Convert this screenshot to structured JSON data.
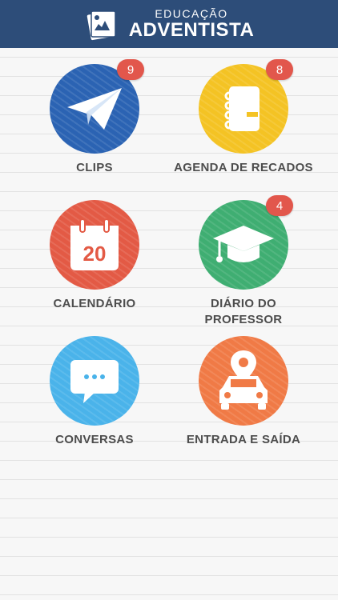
{
  "header": {
    "logo_line1": "EDUCAÇÃO",
    "logo_line2": "ADVENTISTA",
    "bg_color": "#2d4d79"
  },
  "tiles": [
    {
      "label": "CLIPS",
      "badge": "9",
      "icon": "paper-plane-icon",
      "color": "#2b63b3"
    },
    {
      "label": "AGENDA DE RECADOS",
      "badge": "8",
      "icon": "notebook-icon",
      "color": "#f4c324"
    },
    {
      "label": "CALENDÁRIO",
      "badge": "",
      "icon": "calendar-icon",
      "color": "#e35a45",
      "day": "20"
    },
    {
      "label_line1": "DIÁRIO DO",
      "label_line2": "PROFESSOR",
      "badge": "4",
      "icon": "graduation-cap-icon",
      "color": "#3fae72"
    },
    {
      "label": "CONVERSAS",
      "badge": "",
      "icon": "chat-bubble-icon",
      "color": "#4ab3ea"
    },
    {
      "label": "ENTRADA E SAÍDA",
      "badge": "",
      "icon": "car-location-icon",
      "color": "#f07a46"
    }
  ]
}
